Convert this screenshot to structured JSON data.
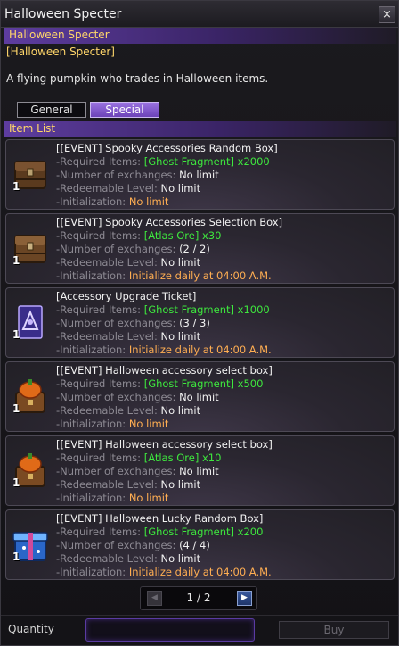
{
  "window": {
    "title": "Halloween Specter",
    "close_glyph": "×"
  },
  "npc": {
    "name": "Halloween Specter",
    "subtitle": "[Halloween Specter]",
    "description": "A flying pumpkin who trades in Halloween items."
  },
  "tabs": [
    {
      "label": "General",
      "active": false
    },
    {
      "label": "Special",
      "active": true
    }
  ],
  "item_list_label": "Item List",
  "labels": {
    "required": "-Required Items:",
    "exchanges": "-Number of exchanges:",
    "level": "-Redeemable Level:",
    "init": "-Initialization:"
  },
  "items": [
    {
      "name": "[[EVENT] Spooky Accessories Random Box]",
      "qty": "1",
      "icon": "wooden-chest-icon",
      "required": "[Ghost Fragment] x2000",
      "exchanges": "No limit",
      "level": "No limit",
      "init": "No limit"
    },
    {
      "name": "[[EVENT] Spooky Accessories Selection Box]",
      "qty": "1",
      "icon": "wooden-chest-icon",
      "required": "[Atlas Ore] x30",
      "exchanges": "(2 / 2)",
      "level": "No limit",
      "init": "Initialize daily at 04:00 A.M."
    },
    {
      "name": "[Accessory Upgrade Ticket]",
      "qty": "1",
      "icon": "ticket-card-icon",
      "required": "[Ghost Fragment] x1000",
      "exchanges": "(3 / 3)",
      "level": "No limit",
      "init": "Initialize daily at 04:00 A.M."
    },
    {
      "name": "[[EVENT] Halloween accessory select box]",
      "qty": "1",
      "icon": "pumpkin-chest-icon",
      "required": "[Ghost Fragment] x500",
      "exchanges": "No limit",
      "level": "No limit",
      "init": "No limit"
    },
    {
      "name": "[[EVENT] Halloween accessory select box]",
      "qty": "1",
      "icon": "pumpkin-chest-icon",
      "required": "[Atlas Ore] x10",
      "exchanges": "No limit",
      "level": "No limit",
      "init": "No limit"
    },
    {
      "name": "[[EVENT] Halloween Lucky Random Box]",
      "qty": "1",
      "icon": "blue-gift-box-icon",
      "required": "[Ghost Fragment] x200",
      "exchanges": "(4 / 4)",
      "level": "No limit",
      "init": "Initialize daily at 04:00 A.M."
    }
  ],
  "pager": {
    "text": "1 / 2",
    "prev_glyph": "◀",
    "next_glyph": "▶"
  },
  "footer": {
    "quantity_label": "Quantity",
    "quantity_value": "",
    "buy_label": "Buy"
  },
  "colors": {
    "header_purple": "#5e3da0",
    "gold_text": "#ffd66a",
    "required_green": "#3ee83e",
    "init_orange": "#ffae52"
  }
}
